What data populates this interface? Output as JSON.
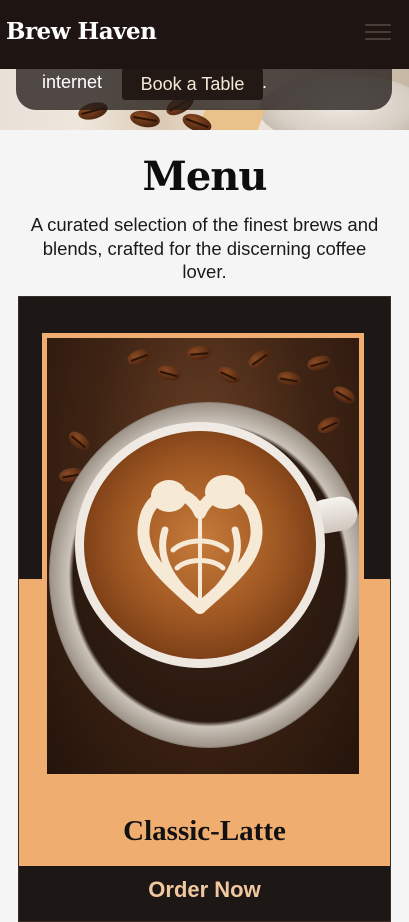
{
  "navbar": {
    "brand": "Brew Haven",
    "menu_icon": "hamburger-menu-icon"
  },
  "hero": {
    "text_prefix": "internet",
    "text_suffix": ".",
    "book_button_label": "Book a Table"
  },
  "menu": {
    "title": "Menu",
    "subtitle": "A curated selection of the finest brews and blends, crafted for the discerning coffee lover."
  },
  "card": {
    "title": "Classic-Latte",
    "order_label": "Order Now",
    "image": "latte-art-image"
  },
  "colors": {
    "navbar_bg": "#1e1512",
    "card_bg": "#1d1716",
    "accent_orange": "#efae6f",
    "order_text": "#efc89e"
  }
}
